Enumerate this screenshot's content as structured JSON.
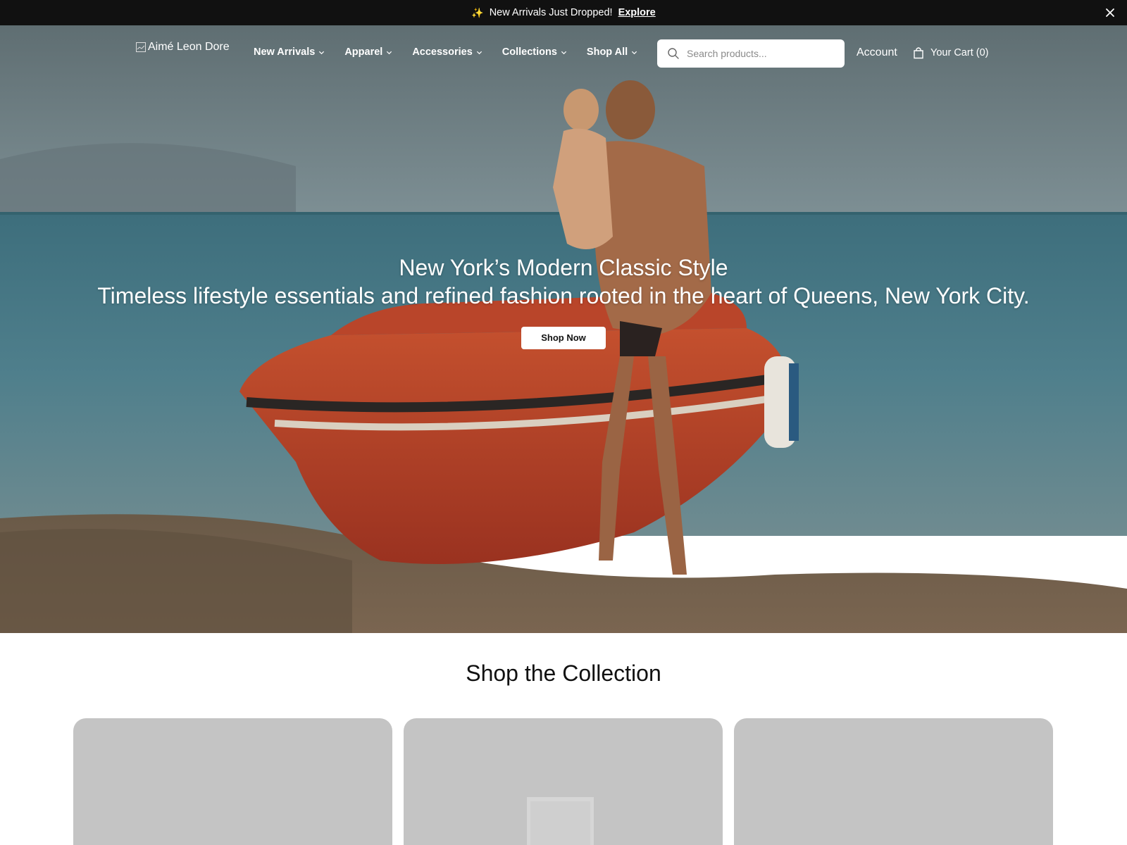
{
  "announcement": {
    "sparkle": "✨",
    "text": "New Arrivals Just Dropped!",
    "link": "Explore"
  },
  "header": {
    "logo_alt": "Aimé Leon Dore",
    "nav": [
      {
        "label": "New Arrivals"
      },
      {
        "label": "Apparel"
      },
      {
        "label": "Accessories"
      },
      {
        "label": "Collections"
      },
      {
        "label": "Shop All"
      }
    ],
    "search_placeholder": "Search products...",
    "account": "Account",
    "cart": "Your Cart (0)"
  },
  "hero": {
    "title": "New York’s Modern Classic Style",
    "subtitle": "Timeless lifestyle essentials and refined fashion rooted in the heart of Queens, New York City.",
    "button": "Shop Now"
  },
  "collection": {
    "title": "Shop the Collection",
    "card_color": "#c4c4c4"
  },
  "icons": [
    "close-icon",
    "chevron-down-icon",
    "search-icon",
    "bag-icon",
    "broken-image-icon"
  ]
}
